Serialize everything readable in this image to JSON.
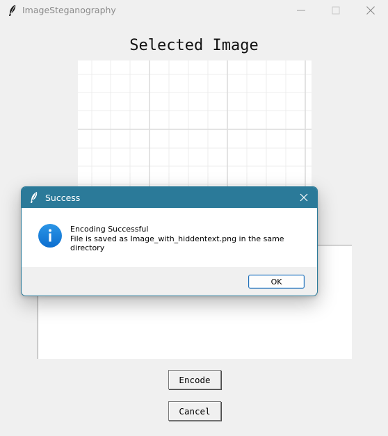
{
  "window": {
    "title": "ImageSteganography",
    "icon": "feather-icon",
    "controls": [
      "minimize-icon",
      "maximize-icon",
      "close-icon"
    ]
  },
  "main": {
    "heading": "Selected Image",
    "text_area_value": "",
    "encode_label": "Encode",
    "cancel_label": "Cancel"
  },
  "dialog": {
    "title": "Success",
    "icon": "info-icon",
    "message_line1": "Encoding Successful",
    "message_line2": "File is saved as Image_with_hiddentext.png in the same directory",
    "ok_label": "OK",
    "accent_color": "#2b7a99"
  }
}
